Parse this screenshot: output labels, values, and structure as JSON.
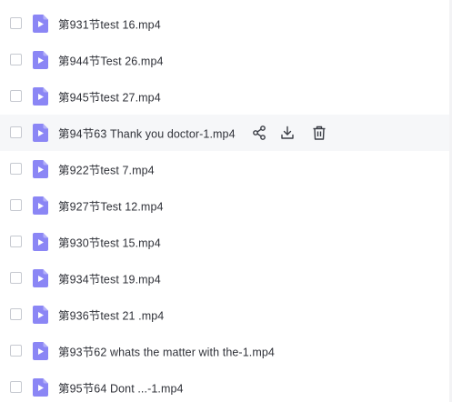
{
  "files": [
    {
      "name": "第931节test 16.mp4",
      "icon": "video-file-icon"
    },
    {
      "name": "第944节Test 26.mp4",
      "icon": "video-file-icon"
    },
    {
      "name": "第945节test 27.mp4",
      "icon": "video-file-icon"
    },
    {
      "name": "第94节63 Thank you doctor-1.mp4",
      "icon": "video-file-icon",
      "hovered": true
    },
    {
      "name": "第922节test 7.mp4",
      "icon": "video-file-icon"
    },
    {
      "name": "第927节Test 12.mp4",
      "icon": "video-file-icon"
    },
    {
      "name": "第930节test 15.mp4",
      "icon": "video-file-icon"
    },
    {
      "name": "第934节test 19.mp4",
      "icon": "video-file-icon"
    },
    {
      "name": "第936节test 21 .mp4",
      "icon": "video-file-icon"
    },
    {
      "name": "第93节62 whats the matter with the-1.mp4",
      "icon": "video-file-icon"
    },
    {
      "name": "第95节64 Dont ...-1.mp4",
      "icon": "video-file-icon"
    }
  ],
  "row_actions": [
    "share-icon",
    "download-icon",
    "delete-icon"
  ],
  "colors": {
    "file_icon": "#8b86f5",
    "text": "#2f3138",
    "hover_bg": "#f6f7f9",
    "action_icon": "#3a3d45"
  }
}
